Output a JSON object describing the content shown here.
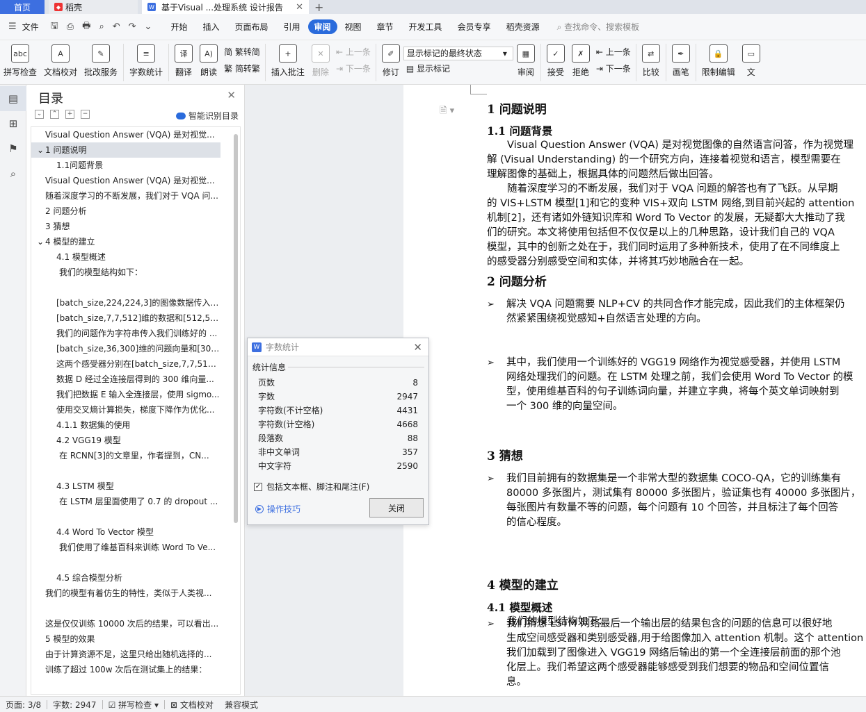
{
  "tabs": [
    {
      "label": "首页"
    },
    {
      "label": "稻壳"
    },
    {
      "label": "基于Visual ...处理系统 设计报告"
    }
  ],
  "menu": {
    "file": "文件",
    "items": [
      "开始",
      "插入",
      "页面布局",
      "引用",
      "审阅",
      "视图",
      "章节",
      "开发工具",
      "会员专享",
      "稻壳资源"
    ],
    "active": "审阅",
    "search": "查找命令、搜索模板"
  },
  "ribbon": {
    "spell": "拼写检查",
    "doc_check": "文档校对",
    "annotate_service": "批改服务",
    "word_count": "字数统计",
    "translate": "翻译",
    "read": "朗读",
    "trad": "繁转简",
    "simp": "简转繁",
    "insert_comment": "插入批注",
    "delete": "删除",
    "prev": "上一条",
    "next": "下一条",
    "revise": "修订",
    "markup_state": "显示标记的最终状态",
    "show_markup": "显示标记",
    "review": "审阅",
    "accept": "接受",
    "reject": "拒绝",
    "prev2": "上一条",
    "next2": "下一条",
    "compare": "比较",
    "pen": "画笔",
    "restrict": "限制编辑",
    "more": "文"
  },
  "toc": {
    "title": "目录",
    "ai_label": "智能识别目录",
    "items": [
      {
        "text": "Visual Question Answer (VQA) 是对视觉...",
        "indent": 0,
        "sel": false,
        "arrow": ""
      },
      {
        "text": "1  问题说明",
        "indent": 0,
        "sel": true,
        "arrow": "⌄"
      },
      {
        "text": "1.1问题背景",
        "indent": 2,
        "sel": false,
        "arrow": ""
      },
      {
        "text": "Visual Question Answer (VQA) 是对视觉...",
        "indent": 0,
        "sel": false,
        "arrow": ""
      },
      {
        "text": "随着深度学习的不断发展，我们对于 VQA 问...",
        "indent": 0,
        "sel": false,
        "arrow": ""
      },
      {
        "text": "2  问题分析",
        "indent": 0,
        "sel": false,
        "arrow": ""
      },
      {
        "text": "3  猜想",
        "indent": 0,
        "sel": false,
        "arrow": ""
      },
      {
        "text": "4  模型的建立",
        "indent": 0,
        "sel": false,
        "arrow": "⌄"
      },
      {
        "text": "4.1  模型概述",
        "indent": 2,
        "sel": false,
        "arrow": ""
      },
      {
        "text": "我们的模型结构如下：",
        "indent": 3,
        "sel": false,
        "arrow": ""
      },
      {
        "text": "",
        "indent": 0,
        "sel": false,
        "arrow": ""
      },
      {
        "text": "[batch_size,224,224,3]的图像数据传入 V...",
        "indent": 2,
        "sel": false,
        "arrow": ""
      },
      {
        "text": "[batch_size,7,7,512]维的数据和[512,512...",
        "indent": 2,
        "sel": false,
        "arrow": ""
      },
      {
        "text": "我们的问题作为字符串传入我们训练好的 ...",
        "indent": 2,
        "sel": false,
        "arrow": ""
      },
      {
        "text": "[batch_size,36,300]维的问题向量和[300,...",
        "indent": 2,
        "sel": false,
        "arrow": ""
      },
      {
        "text": "这两个感受器分别在[batch_size,7,7,512] ...",
        "indent": 2,
        "sel": false,
        "arrow": ""
      },
      {
        "text": "数据 D 经过全连接层得到的 300 维向量...",
        "indent": 2,
        "sel": false,
        "arrow": ""
      },
      {
        "text": "我们把数据 E 输入全连接层，使用 sigmo...",
        "indent": 2,
        "sel": false,
        "arrow": ""
      },
      {
        "text": "使用交叉熵计算损失，梯度下降作为优化...",
        "indent": 2,
        "sel": false,
        "arrow": ""
      },
      {
        "text": "4.1.1  数据集的使用",
        "indent": 2,
        "sel": false,
        "arrow": ""
      },
      {
        "text": "4.2 VGG19 模型",
        "indent": 2,
        "sel": false,
        "arrow": ""
      },
      {
        "text": "在 RCNN[3]的文章里，作者提到，CN...",
        "indent": 3,
        "sel": false,
        "arrow": ""
      },
      {
        "text": "",
        "indent": 0,
        "sel": false,
        "arrow": ""
      },
      {
        "text": "4.3 LSTM 模型",
        "indent": 2,
        "sel": false,
        "arrow": ""
      },
      {
        "text": "在 LSTM 层里面使用了 0.7 的 dropout ...",
        "indent": 3,
        "sel": false,
        "arrow": ""
      },
      {
        "text": "",
        "indent": 0,
        "sel": false,
        "arrow": ""
      },
      {
        "text": "4.4 Word To Vector 模型",
        "indent": 2,
        "sel": false,
        "arrow": ""
      },
      {
        "text": "我们使用了维基百科来训练 Word To Ve...",
        "indent": 3,
        "sel": false,
        "arrow": ""
      },
      {
        "text": "",
        "indent": 0,
        "sel": false,
        "arrow": ""
      },
      {
        "text": "4.5  综合模型分析",
        "indent": 2,
        "sel": false,
        "arrow": ""
      },
      {
        "text": "我们的模型有着仿生的特性，类似于人类视...",
        "indent": 0,
        "sel": false,
        "arrow": ""
      },
      {
        "text": "",
        "indent": 0,
        "sel": false,
        "arrow": ""
      },
      {
        "text": "这是仅仅训练 10000 次后的结果，可以看出...",
        "indent": 0,
        "sel": false,
        "arrow": ""
      },
      {
        "text": "5  模型的效果",
        "indent": 0,
        "sel": false,
        "arrow": ""
      },
      {
        "text": "由于计算资源不足，这里只给出随机选择的...",
        "indent": 0,
        "sel": false,
        "arrow": ""
      },
      {
        "text": "训练了超过 100w 次后在测试集上的结果：",
        "indent": 0,
        "sel": false,
        "arrow": ""
      }
    ]
  },
  "dialog": {
    "title": "字数统计",
    "section": "统计信息",
    "rows": [
      {
        "label": "页数",
        "value": "8"
      },
      {
        "label": "字数",
        "value": "2947"
      },
      {
        "label": "字符数(不计空格)",
        "value": "4431"
      },
      {
        "label": "字符数(计空格)",
        "value": "4668"
      },
      {
        "label": "段落数",
        "value": "88"
      },
      {
        "label": "非中文单词",
        "value": "357"
      },
      {
        "label": "中文字符",
        "value": "2590"
      }
    ],
    "include_label": "包括文本框、脚注和尾注(F)",
    "tips": "操作技巧",
    "close": "关闭"
  },
  "doc": {
    "h1_1": "1  问题说明",
    "h2_1": "1.1  问题背景",
    "p1": [
      "　　Visual Question Answer (VQA) 是对视觉图像的自然语言问答，作为视觉理",
      "解 (Visual Understanding) 的一个研究方向，连接着视觉和语言，模型需要在",
      "理解图像的基础上，根据具体的问题然后做出回答。"
    ],
    "p2": [
      "　　随着深度学习的不断发展，我们对于 VQA 问题的解答也有了飞跃。从早期",
      "的 VIS+LSTM 模型[1]和它的变种 VIS+双向 LSTM 网络,到目前兴起的 attention",
      "机制[2]，还有诸如外链知识库和 Word To Vector 的发展，无疑都大大推动了我",
      "们的研究。本文将使用包括但不仅仅是以上的几种思路，设计我们自己的 VQA",
      "模型，其中的创新之处在于，我们同时运用了多种新技术，使用了在不同维度上",
      "的感受器分别感受空间和实体，并将其巧妙地融合在一起。"
    ],
    "h1_2": "2  问题分析",
    "b1": [
      "解决 VQA 问题需要 NLP+CV 的共同合作才能完成，因此我们的主体框架仍",
      "然紧紧围绕视觉感知+自然语言处理的方向。"
    ],
    "b2": [
      "其中，我们使用一个训练好的 VGG19 网络作为视觉感受器，并使用 LSTM",
      "网络处理我们的问题。在 LSTM 处理之前，我们会使用 Word To Vector 的模",
      "型，使用维基百科的句子训练词向量，并建立字典，将每个英文单词映射到",
      "一个 300 维的向量空间。"
    ],
    "b3": [
      "我们目前拥有的数据集是一个非常大型的数据集 COCO-QA，它的训练集有",
      "80000 多张图片，测试集有 80000 多张图片，验证集也有 40000 多张图片，",
      "每张图片有数量不等的问题，每个问题有 10 个回答，并且标注了每个回答",
      "的信心程度。"
    ],
    "h1_3": "3  猜想",
    "b4": [
      "我们猜想 LSTM 网络最后一个输出层的结果包含的问题的信息可以很好地",
      "生成空间感受器和类别感受器,用于给图像加入 attention 机制。这个 attention",
      "我们加载到了图像进入 VGG19 网络后输出的第一个全连接层前面的那个池",
      "化层上。我们希望这两个感受器能够感受到我们想要的物品和空间位置信",
      "息。"
    ],
    "h1_4": "4  模型的建立",
    "h2_2": "4.1  模型概述",
    "p3": "　　我们的模型结构如下："
  },
  "status": {
    "page": "页面: 3/8",
    "words": "字数: 2947",
    "spell": "拼写检查",
    "doc_check": "文档校对",
    "compat": "兼容模式"
  }
}
